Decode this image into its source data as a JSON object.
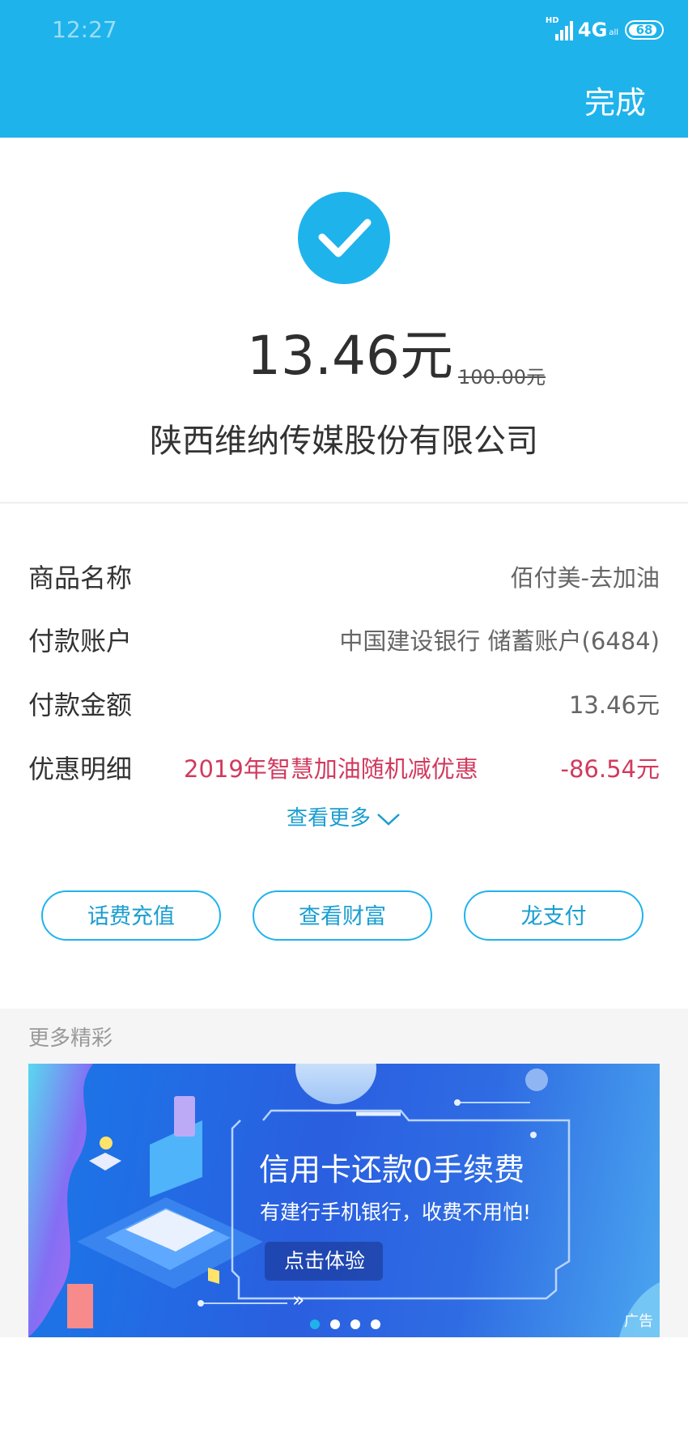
{
  "status_bar": {
    "time": "12:27",
    "hd": "HD",
    "network": "4G",
    "network_sub": "all",
    "battery": "68"
  },
  "header": {
    "done_label": "完成"
  },
  "result": {
    "amount": "13.46元",
    "original_amount": "100.00元",
    "merchant": "陕西维纳传媒股份有限公司"
  },
  "details": [
    {
      "label": "商品名称",
      "value": "佰付美-去加油"
    },
    {
      "label": "付款账户",
      "value": "中国建设银行 储蓄账户(6484)"
    },
    {
      "label": "付款金额",
      "value": "13.46元"
    }
  ],
  "promo": {
    "label": "优惠明细",
    "description": "2019年智慧加油随机减优惠",
    "value": "-86.54元"
  },
  "view_more": "查看更多",
  "actions": [
    "话费充值",
    "查看财富",
    "龙支付"
  ],
  "more_section": {
    "title": "更多精彩"
  },
  "banner": {
    "title": "信用卡还款0手续费",
    "subtitle": "有建行手机银行，收费不用怕!",
    "cta": "点击体验",
    "ad_tag": "广告",
    "dots": 4,
    "active_dot": 0
  },
  "colors": {
    "brand": "#1fb3ec",
    "promo": "#d23a5e"
  }
}
